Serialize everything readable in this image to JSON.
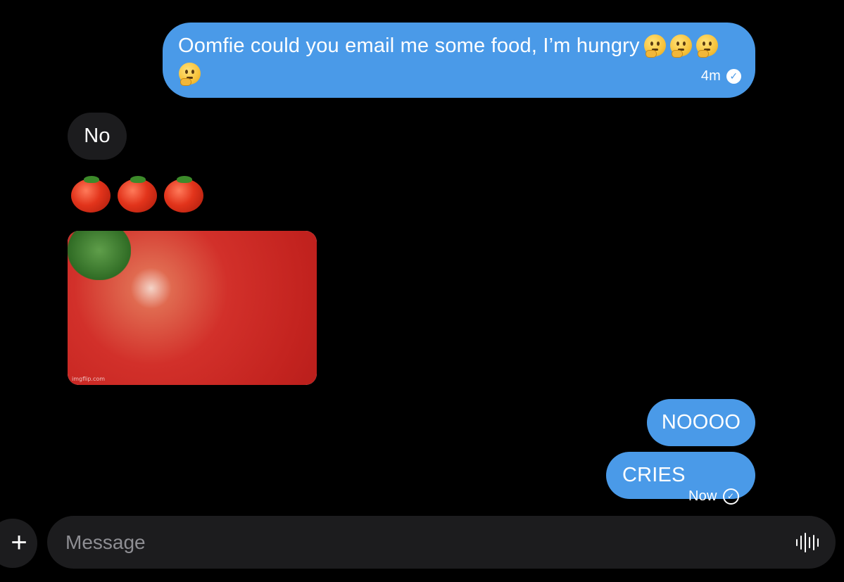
{
  "messages": [
    {
      "direction": "out",
      "text": "Oomfie could you email me some food, I’m hungry",
      "emojis": [
        "thinking-face-emoji",
        "thinking-face-emoji",
        "thinking-face-emoji",
        "thinking-face-emoji"
      ],
      "time": "4m",
      "status": "seen"
    },
    {
      "direction": "in",
      "text": "No"
    },
    {
      "direction": "in",
      "emojis": [
        "tomato-emoji",
        "tomato-emoji",
        "tomato-emoji"
      ]
    },
    {
      "direction": "in",
      "attachment": "tomato-gif",
      "watermark": "imgflip.com"
    },
    {
      "direction": "out",
      "text": "NOOOO"
    },
    {
      "direction": "out",
      "text": "CRIES",
      "time": "Now",
      "status": "sent"
    }
  ],
  "composer": {
    "placeholder": "Message",
    "plus_icon": "+",
    "voice_icon": "waveform-icon"
  },
  "colors": {
    "background": "#000000",
    "outgoing_bubble": "#4a9ae8",
    "incoming_bubble": "#1c1c1e",
    "composer_bg": "#1c1c1e",
    "placeholder_text": "#8e8e93"
  }
}
